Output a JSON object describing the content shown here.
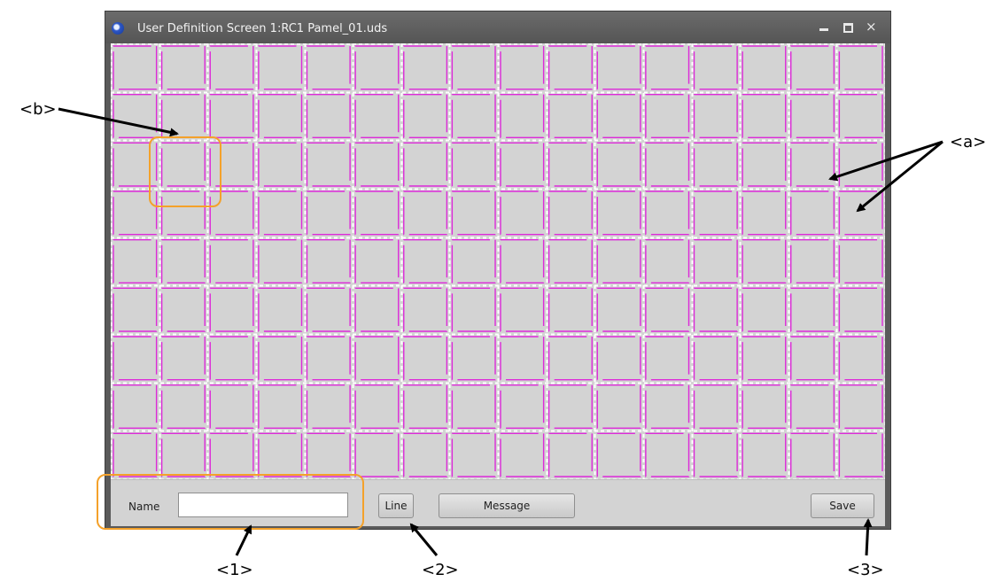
{
  "window": {
    "title": "User Definition Screen 1:RC1 Pamel_01.uds",
    "controls": {
      "minimize_icon": "minimize-icon",
      "maximize_icon": "maximize-icon",
      "close_icon": "close-icon",
      "close_glyph": "×"
    }
  },
  "grid": {
    "columns": 16,
    "rows": 9,
    "cell_line_color": "#dd2ad9",
    "gap_color": "#ffffff",
    "background": "#d3d3d3"
  },
  "bottom_bar": {
    "name_label": "Name",
    "name_value": "",
    "line_button": "Line",
    "message_button": "Message",
    "save_button": "Save"
  },
  "annotations": {
    "a": "<a>",
    "b": "<b>",
    "one": "<1>",
    "two": "<2>",
    "three": "<3>",
    "highlight_color": "#f4a12a"
  }
}
